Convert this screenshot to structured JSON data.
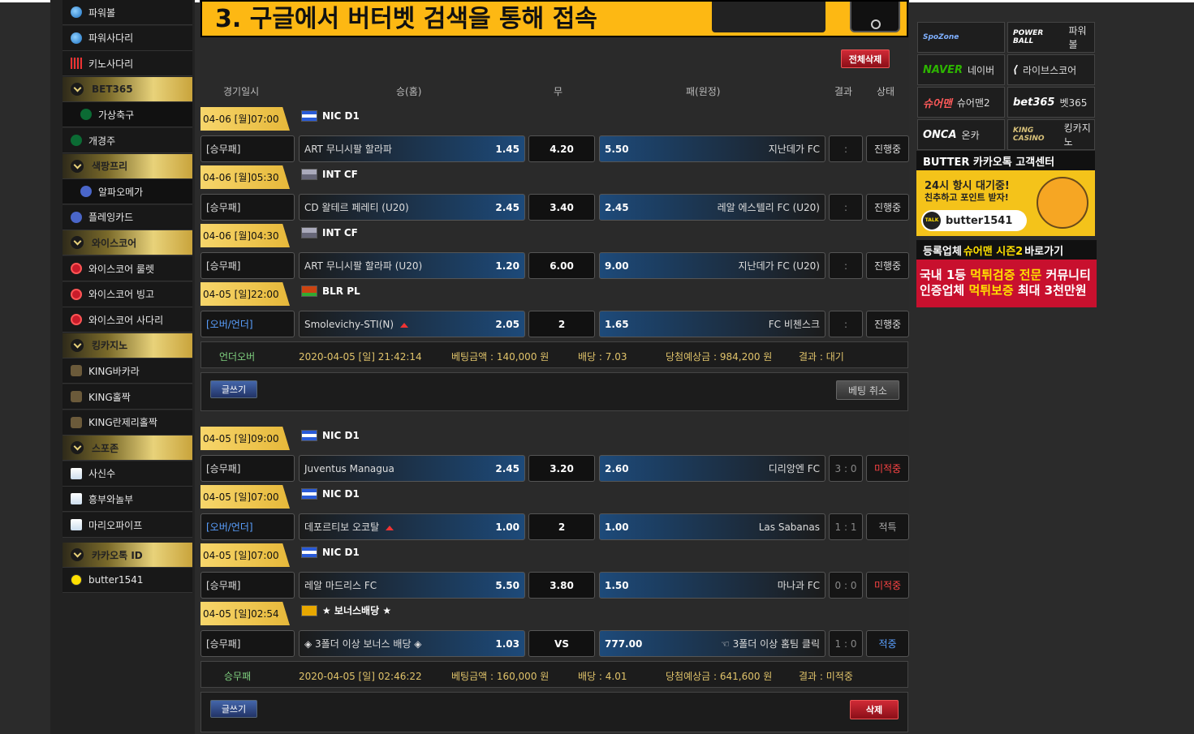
{
  "sidebar": {
    "items": [
      {
        "label": "파워볼",
        "kind": "item",
        "icon": "powerball-icon"
      },
      {
        "label": "파워사다리",
        "kind": "item",
        "icon": "powerladder-icon"
      },
      {
        "label": "키노사다리",
        "kind": "item",
        "icon": "keno-icon"
      },
      {
        "label": "BET365",
        "kind": "header"
      },
      {
        "label": "가상축구",
        "kind": "sub",
        "icon": "bet365-icon"
      },
      {
        "label": "개경주",
        "kind": "item",
        "icon": "bet365-icon"
      },
      {
        "label": "색팡프리",
        "kind": "header"
      },
      {
        "label": "알파오메가",
        "kind": "sub",
        "icon": "star-icon"
      },
      {
        "label": "플레잉카드",
        "kind": "item",
        "icon": "star-icon"
      },
      {
        "label": "와이스코어",
        "kind": "header"
      },
      {
        "label": "와이스코어 룰렛",
        "kind": "item",
        "icon": "yscore-icon"
      },
      {
        "label": "와이스코어 빙고",
        "kind": "item",
        "icon": "yscore-icon"
      },
      {
        "label": "와이스코어 사다리",
        "kind": "item",
        "icon": "yscore-icon"
      },
      {
        "label": "킹카지노",
        "kind": "header"
      },
      {
        "label": "KING바카라",
        "kind": "item",
        "icon": "king-icon"
      },
      {
        "label": "KING홀짝",
        "kind": "item",
        "icon": "king-icon"
      },
      {
        "label": "KING란제리홀짝",
        "kind": "item",
        "icon": "king-icon"
      },
      {
        "label": "스포존",
        "kind": "header"
      },
      {
        "label": "사신수",
        "kind": "item",
        "icon": "spozone-icon"
      },
      {
        "label": "흥부와놀부",
        "kind": "item",
        "icon": "spozone-icon"
      },
      {
        "label": "마리오파이프",
        "kind": "item",
        "icon": "spozone-icon"
      }
    ],
    "kakao_header": "카카오톡 ID",
    "kakao_id": "butter1541"
  },
  "banner": {
    "text": "3. 구글에서 버터벳 검색을 통해 접속"
  },
  "toolbar": {
    "delete_all": "전체삭제"
  },
  "columns": {
    "date": "경기일시",
    "home": "승(홈)",
    "draw": "무",
    "away": "패(원정)",
    "result": "결과",
    "state": "상태"
  },
  "bets": [
    {
      "date": "04-06 [월]07:00",
      "league": "NIC D1",
      "flag": "nic",
      "type": "[승무패]",
      "home": "ART 무니시팔 할라파",
      "home_odd": "1.45",
      "draw": "4.20",
      "away_odd": "5.50",
      "away": "지난데가 FC",
      "result": ":",
      "state": "진행중"
    },
    {
      "date": "04-06 [월]05:30",
      "league": "INT CF",
      "flag": "int",
      "type": "[승무패]",
      "home": "CD 왈테르 페레티 (U20)",
      "home_odd": "2.45",
      "draw": "3.40",
      "away_odd": "2.45",
      "away": "레알 에스텔리 FC (U20)",
      "result": ":",
      "state": "진행중"
    },
    {
      "date": "04-06 [월]04:30",
      "league": "INT CF",
      "flag": "int",
      "type": "[승무패]",
      "home": "ART 무니시팔 할라파 (U20)",
      "home_odd": "1.20",
      "draw": "6.00",
      "away_odd": "9.00",
      "away": "지난데가 FC (U20)",
      "result": ":",
      "state": "진행중"
    },
    {
      "date": "04-05 [일]22:00",
      "league": "BLR PL",
      "flag": "blr",
      "type": "[오버/언더]",
      "home": "Smolevichy-STI(N)",
      "home_odd": "2.05",
      "draw": "2",
      "away_odd": "1.65",
      "away": "FC 비첸스크",
      "result": ":",
      "state": "진행중"
    }
  ],
  "summary1": {
    "kind": "언더오버",
    "datetime": "2020-04-05 [일] 21:42:14",
    "amount": "베팅금액 : 140,000 원",
    "odds": "배당 : 7.03",
    "expected": "당첨예상금 : 984,200 원",
    "result": "결과 : 대기"
  },
  "actions1": {
    "write": "글쓰기",
    "cancel": "베팅 취소"
  },
  "bets2": [
    {
      "date": "04-05 [일]09:00",
      "league": "NIC D1",
      "flag": "nic",
      "type": "[승무패]",
      "home": "Juventus Managua",
      "home_odd": "2.45",
      "draw": "3.20",
      "away_odd": "2.60",
      "away": "디리앙엔 FC",
      "result": "3 : 0",
      "state": "미적중"
    },
    {
      "date": "04-05 [일]07:00",
      "league": "NIC D1",
      "flag": "nic",
      "type": "[오버/언더]",
      "home": "데포르티보 오코탈",
      "home_odd": "1.00",
      "draw": "2",
      "away_odd": "1.00",
      "away": "Las Sabanas",
      "result": "1 : 1",
      "state": "적특"
    },
    {
      "date": "04-05 [일]07:00",
      "league": "NIC D1",
      "flag": "nic",
      "type": "[승무패]",
      "home": "레알 마드리스 FC",
      "home_odd": "5.50",
      "draw": "3.80",
      "away_odd": "1.50",
      "away": "마나과 FC",
      "result": "0 : 0",
      "state": "미적중"
    },
    {
      "date": "04-05 [일]02:54",
      "league": "★ 보너스배당 ★",
      "flag": "bonus",
      "type": "[승무패]",
      "home": "◈ 3폴더 이상 보너스 배당 ◈",
      "home_odd": "1.03",
      "draw": "VS",
      "away_odd": "777.00",
      "away": "☜ 3폴더 이상 홈팀 클릭",
      "result": "1 : 0",
      "state": "적중"
    }
  ],
  "summary2": {
    "kind": "승무패",
    "datetime": "2020-04-05 [일] 02:46:22",
    "amount": "베팅금액 : 160,000 원",
    "odds": "배당 : 4.01",
    "expected": "당첨예상금 : 641,600 원",
    "result": "결과 : 미적중"
  },
  "actions2": {
    "write": "글쓰기",
    "delete": "삭제"
  },
  "partners": [
    {
      "logo": "SpoZone",
      "label": ""
    },
    {
      "logo": "POWER BALL",
      "label": "파워볼"
    },
    {
      "logo": "NAVER",
      "label": "네이버"
    },
    {
      "logo": "⟨",
      "label": "라이브스코어"
    },
    {
      "logo": "슈어맨",
      "label": "슈어맨2"
    },
    {
      "logo": "bet365",
      "label": "벳365"
    },
    {
      "logo": "ONCA",
      "label": "온카"
    },
    {
      "logo": "KING CASINO",
      "label": "킹카지노"
    }
  ],
  "kakao": {
    "title": "BUTTER 카카오톡 고객센터",
    "line1": "24시 항시 대기중!",
    "line2": "친추하고 포인트 받자!",
    "talk": "TALK",
    "id": "butter1541"
  },
  "sureman": {
    "title_a": "등록업체 ",
    "title_b": "슈어맨 시즌2",
    "title_c": " 바로가기",
    "l1a": "국내 1등 ",
    "l1b": "먹튀검증 전문",
    "l1c": " 커뮤니티",
    "l2a": "인증업체 ",
    "l2b": "먹튀보증",
    "l2c": " 최대 3천만원"
  },
  "colors": {
    "gold": "#e8d27a",
    "banner": "#fdb813",
    "red": "#c8102e",
    "blue": "#1d4a7a"
  }
}
